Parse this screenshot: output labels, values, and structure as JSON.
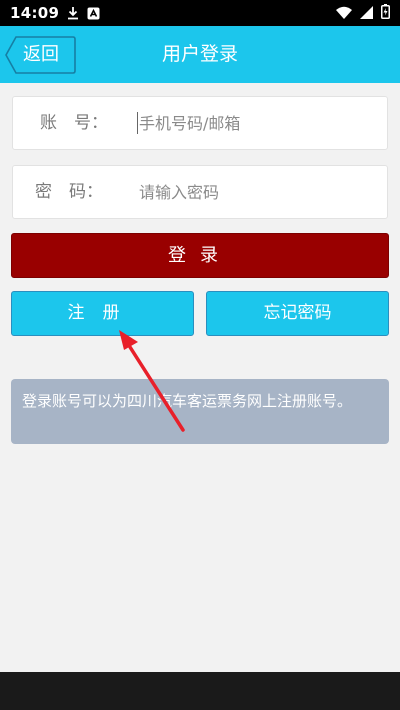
{
  "status_bar": {
    "time": "14:09",
    "icons_left": [
      "download-icon",
      "app-notification-icon"
    ],
    "icons_right": [
      "wifi-icon",
      "signal-icon",
      "battery-icon"
    ]
  },
  "header": {
    "back_label": "返回",
    "title": "用户登录"
  },
  "form": {
    "account_label": "账　号：",
    "account_placeholder": "手机号码/邮箱",
    "account_value": "",
    "password_label": "密　码：",
    "password_placeholder": "请输入密码",
    "password_value": ""
  },
  "buttons": {
    "login": "登录",
    "register": "注册",
    "forgot_password": "忘记密码"
  },
  "notice": {
    "text": "登录账号可以为四川汽车客运票务网上注册账号。"
  },
  "colors": {
    "header": "#1cc6ec",
    "login_button": "#990000",
    "secondary_button": "#1cc6ec",
    "notice": "#a7b4c6",
    "annotation_arrow": "#e8202a"
  }
}
